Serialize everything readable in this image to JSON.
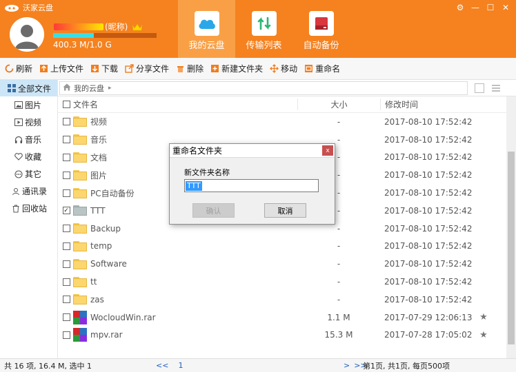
{
  "app": {
    "title": "沃家云盘"
  },
  "window_controls": {
    "settings": "⚙",
    "minimize": "—",
    "maximize": "☐",
    "close": "✕"
  },
  "user": {
    "nickname_suffix": "(昵称)",
    "quota_text": "400.3 M/1.0 G",
    "quota_fraction": 0.39
  },
  "nav": {
    "tabs": [
      {
        "label": "我的云盘",
        "icon": "cloud-icon",
        "active": true
      },
      {
        "label": "传输列表",
        "icon": "transfer-icon",
        "active": false
      },
      {
        "label": "自动备份",
        "icon": "backup-icon",
        "active": false
      }
    ]
  },
  "toolbar": {
    "refresh": "刷新",
    "upload": "上传文件",
    "download": "下载",
    "share": "分享文件",
    "delete": "删除",
    "new_folder": "新建文件夹",
    "move": "移动",
    "rename": "重命名"
  },
  "sidebar": {
    "all_files": "全部文件",
    "pictures": "图片",
    "videos": "视频",
    "music": "音乐",
    "favorites": "收藏",
    "others": "其它",
    "contacts": "通讯录",
    "recycle": "回收站"
  },
  "path": {
    "root": "我的云盘"
  },
  "columns": {
    "name": "文件名",
    "size": "大小",
    "date": "修改时间"
  },
  "files": [
    {
      "name": "视频",
      "type": "folder",
      "size": "-",
      "date": "2017-08-10 17:52:42"
    },
    {
      "name": "音乐",
      "type": "folder",
      "size": "-",
      "date": "2017-08-10 17:52:42"
    },
    {
      "name": "文档",
      "type": "folder",
      "size": "-",
      "date": "2017-08-10 17:52:42"
    },
    {
      "name": "图片",
      "type": "folder",
      "size": "-",
      "date": "2017-08-10 17:52:42"
    },
    {
      "name": "PC自动备份",
      "type": "folder",
      "size": "-",
      "date": "2017-08-10 17:52:42"
    },
    {
      "name": "TTT",
      "type": "folder-grey",
      "size": "-",
      "date": "2017-08-10 17:52:42",
      "checked": true
    },
    {
      "name": "Backup",
      "type": "folder",
      "size": "-",
      "date": "2017-08-10 17:52:42"
    },
    {
      "name": "temp",
      "type": "folder",
      "size": "-",
      "date": "2017-08-10 17:52:42"
    },
    {
      "name": "Software",
      "type": "folder",
      "size": "-",
      "date": "2017-08-10 17:52:42"
    },
    {
      "name": "tt",
      "type": "folder",
      "size": "-",
      "date": "2017-08-10 17:52:42"
    },
    {
      "name": "zas",
      "type": "folder",
      "size": "-",
      "date": "2017-08-10 17:52:42"
    },
    {
      "name": "WocloudWin.rar",
      "type": "rar",
      "size": "1.1 M",
      "date": "2017-07-29 12:06:13",
      "starred": true
    },
    {
      "name": "mpv.rar",
      "type": "rar",
      "size": "15.3 M",
      "date": "2017-07-28 17:05:02",
      "starred": true
    }
  ],
  "status": {
    "summary": "共 16 项, 16.4 M, 选中 1",
    "prev": "<<",
    "prev_one": "<",
    "page": "1",
    "next_one": ">",
    "next": ">>",
    "page_info": "第1页, 共1页, 每页500项"
  },
  "dialog": {
    "title": "重命名文件夹",
    "label": "新文件夹名称",
    "value": "TTT",
    "ok": "确认",
    "cancel": "取消"
  },
  "colors": {
    "header": "#f5821f",
    "active_tab": "#f9a046",
    "sidebar_active": "#cde6f7",
    "link": "#1f5fbf"
  }
}
